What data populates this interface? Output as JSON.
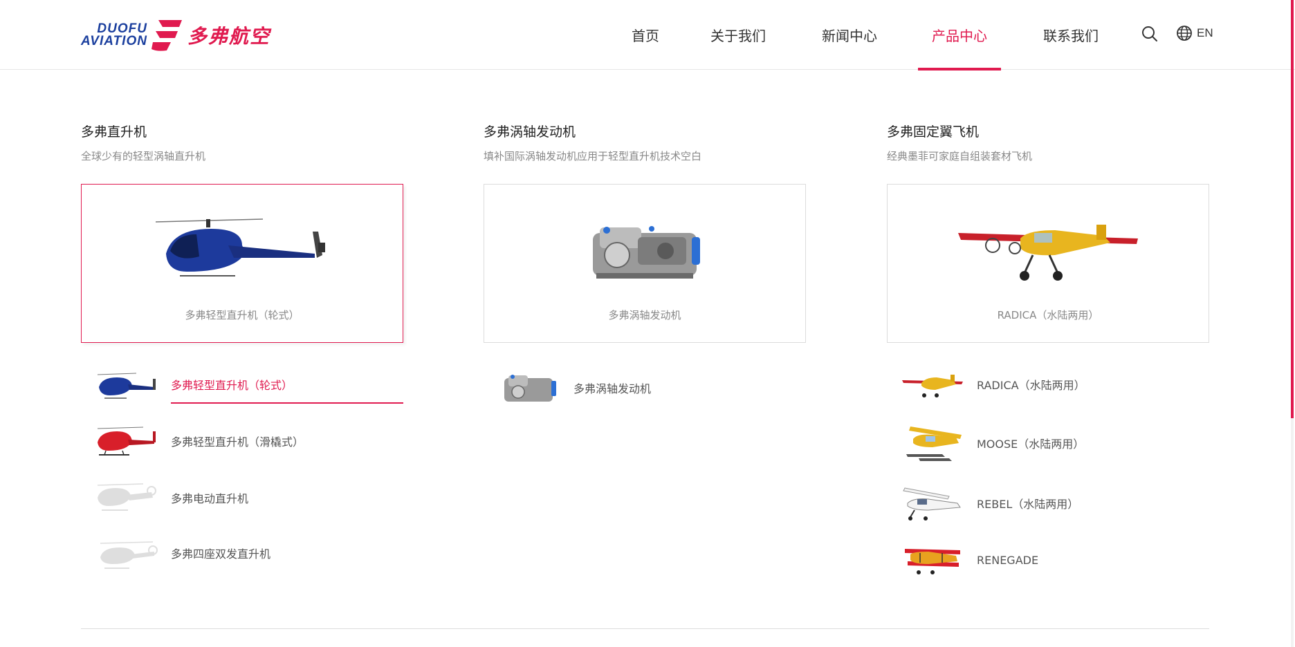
{
  "brand": {
    "name_en_line1": "DUOFU",
    "name_en_line2": "AVIATION",
    "name_cn": "多弗航空",
    "primary_color": "#e01a4f",
    "secondary_color": "#1b3f9e"
  },
  "nav": {
    "items": [
      {
        "label": "首页"
      },
      {
        "label": "关于我们"
      },
      {
        "label": "新闻中心"
      },
      {
        "label": "产品中心"
      },
      {
        "label": "联系我们"
      }
    ],
    "active": "产品中心",
    "search_icon": "search-icon",
    "lang_icon": "globe-icon",
    "lang_label": "EN"
  },
  "columns": [
    {
      "title": "多弗直升机",
      "subtitle": "全球少有的轻型涡轴直升机",
      "feature_caption": "多弗轻型直升机（轮式）",
      "feature_active": true,
      "items": [
        {
          "label": "多弗轻型直升机（轮式）",
          "thumb": "helicopter-blue"
        },
        {
          "label": "多弗轻型直升机（滑橇式）",
          "thumb": "helicopter-red"
        },
        {
          "label": "多弗电动直升机",
          "thumb": "helicopter-placeholder"
        },
        {
          "label": "多弗四座双发直升机",
          "thumb": "helicopter-placeholder"
        }
      ],
      "active_item": 0
    },
    {
      "title": "多弗涡轴发动机",
      "subtitle": "填补国际涡轴发动机应用于轻型直升机技术空白",
      "feature_caption": "多弗涡轴发动机",
      "feature_active": false,
      "items": [
        {
          "label": "多弗涡轴发动机",
          "thumb": "engine"
        }
      ]
    },
    {
      "title": "多弗固定翼飞机",
      "subtitle": "经典墨菲可家庭自组装套材飞机",
      "feature_caption": "RADICA（水陆两用）",
      "feature_active": false,
      "items": [
        {
          "label": "RADICA（水陆两用）",
          "thumb": "plane-yellow"
        },
        {
          "label": "MOOSE（水陆两用）",
          "thumb": "seaplane-yellow"
        },
        {
          "label": "REBEL（水陆两用）",
          "thumb": "plane-white"
        },
        {
          "label": "RENEGADE",
          "thumb": "biplane-red"
        }
      ]
    }
  ]
}
